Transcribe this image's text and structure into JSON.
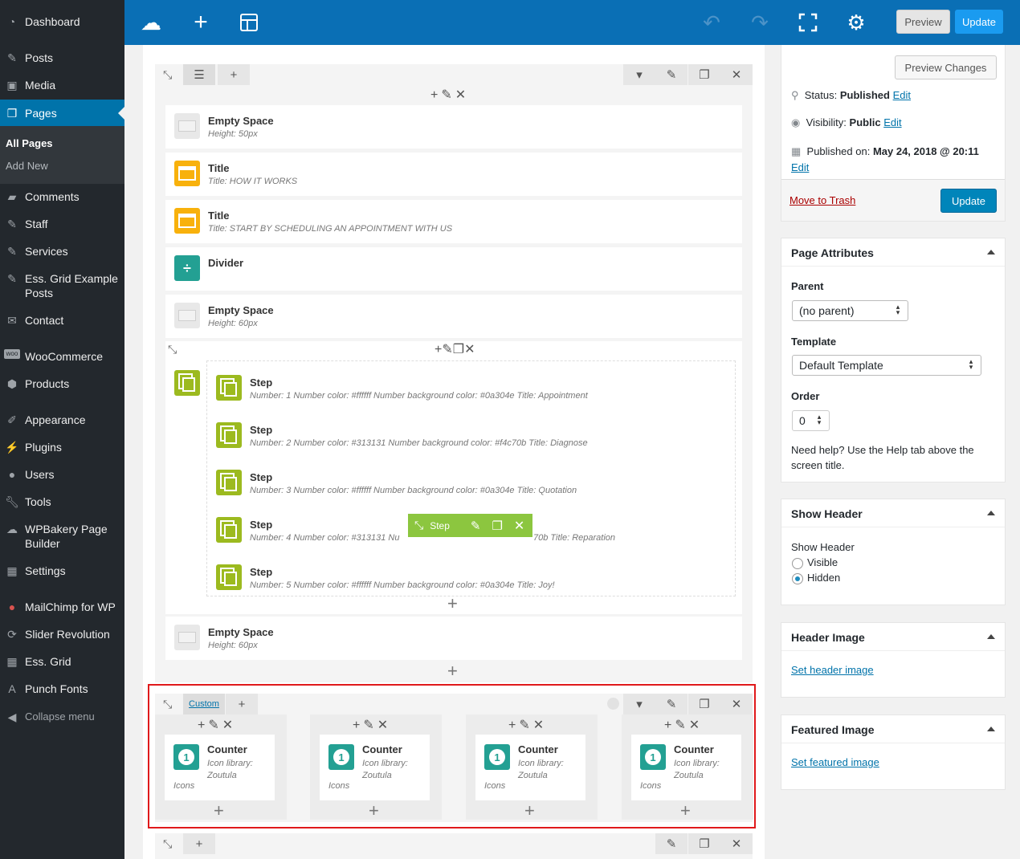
{
  "sidebar": {
    "items": [
      {
        "label": "Dashboard",
        "icon": "dashboard-icon"
      },
      {
        "label": "Posts",
        "icon": "pin-icon"
      },
      {
        "label": "Media",
        "icon": "media-icon"
      },
      {
        "label": "Pages",
        "icon": "pages-icon"
      },
      {
        "label": "Comments",
        "icon": "comment-icon"
      },
      {
        "label": "Staff",
        "icon": "pin-icon"
      },
      {
        "label": "Services",
        "icon": "pin-icon"
      },
      {
        "label": "Ess. Grid Example Posts",
        "icon": "pin-icon"
      },
      {
        "label": "Contact",
        "icon": "mail-icon"
      },
      {
        "label": "WooCommerce",
        "icon": "woo-icon"
      },
      {
        "label": "Products",
        "icon": "box-icon"
      },
      {
        "label": "Appearance",
        "icon": "brush-icon"
      },
      {
        "label": "Plugins",
        "icon": "plug-icon"
      },
      {
        "label": "Users",
        "icon": "user-icon"
      },
      {
        "label": "Tools",
        "icon": "wrench-icon"
      },
      {
        "label": "WPBakery Page Builder",
        "icon": "cloud-icon"
      },
      {
        "label": "Settings",
        "icon": "settings-icon"
      },
      {
        "label": "MailChimp for WP",
        "icon": "mailchimp-icon"
      },
      {
        "label": "Slider Revolution",
        "icon": "refresh-icon"
      },
      {
        "label": "Ess. Grid",
        "icon": "grid-icon"
      },
      {
        "label": "Punch Fonts",
        "icon": "font-icon"
      }
    ],
    "submenu": {
      "all_pages": "All Pages",
      "add_new": "Add New"
    },
    "collapse": "Collapse menu"
  },
  "topbar": {
    "preview": "Preview",
    "update": "Update"
  },
  "builder": {
    "elements": [
      {
        "name": "Empty Space",
        "sub": "Height: 50px"
      },
      {
        "name": "Title",
        "sub": "Title: HOW IT WORKS"
      },
      {
        "name": "Title",
        "sub": "Title: START BY SCHEDULING AN APPOINTMENT WITH US"
      },
      {
        "name": "Divider",
        "sub": ""
      },
      {
        "name": "Empty Space",
        "sub": "Height: 60px"
      }
    ],
    "steps": [
      {
        "name": "Step",
        "sub": "Number: 1  Number color: #ffffff  Number background color: #0a304e  Title: Appointment"
      },
      {
        "name": "Step",
        "sub": "Number: 2  Number color: #313131  Number background color: #f4c70b  Title: Diagnose"
      },
      {
        "name": "Step",
        "sub": "Number: 3  Number color: #ffffff  Number background color: #0a304e  Title: Quotation"
      },
      {
        "name": "Step",
        "sub_left": "Number: 4  Number color: #313131  Nu",
        "sub_right": "70b  Title: Reparation"
      },
      {
        "name": "Step",
        "sub": "Number: 5  Number color: #ffffff  Number background color: #0a304e  Title: Joy!"
      }
    ],
    "step_toolbar_label": "Step",
    "last_empty": {
      "name": "Empty Space",
      "sub": "Height: 60px"
    },
    "custom_label": "Custom",
    "counters": [
      {
        "name": "Counter",
        "sub": "Icon library: Zoutula",
        "icons": "Icons"
      },
      {
        "name": "Counter",
        "sub": "Icon library: Zoutula",
        "icons": "Icons"
      },
      {
        "name": "Counter",
        "sub": "Icon library: Zoutula",
        "icons": "Icons"
      },
      {
        "name": "Counter",
        "sub": "Icon library: Zoutula",
        "icons": "Icons"
      }
    ],
    "counter_number": "1"
  },
  "publish": {
    "preview_changes": "Preview Changes",
    "status_label": "Status:",
    "status_value": "Published",
    "status_edit": "Edit",
    "visibility_label": "Visibility:",
    "visibility_value": "Public",
    "visibility_edit": "Edit",
    "published_label": "Published on:",
    "published_value": "May 24, 2018 @ 20:11",
    "published_edit": "Edit",
    "trash": "Move to Trash",
    "update": "Update"
  },
  "page_attributes": {
    "title": "Page Attributes",
    "parent_label": "Parent",
    "parent_value": "(no parent)",
    "template_label": "Template",
    "template_value": "Default Template",
    "order_label": "Order",
    "order_value": "0",
    "help": "Need help? Use the Help tab above the screen title."
  },
  "show_header": {
    "title": "Show Header",
    "label": "Show Header",
    "opt_visible": "Visible",
    "opt_hidden": "Hidden",
    "selected": "Hidden"
  },
  "header_image": {
    "title": "Header Image",
    "link": "Set header image"
  },
  "featured_image": {
    "title": "Featured Image",
    "link": "Set featured image"
  },
  "colors": {
    "admin_bar": "#23282d",
    "wp_blue": "#0073aa",
    "builder_bar": "#0a6fb5",
    "title_icon": "#f8b10c",
    "step_icon": "#9cba1f",
    "counter_icon": "#23a093",
    "highlight": "#e0191b"
  }
}
